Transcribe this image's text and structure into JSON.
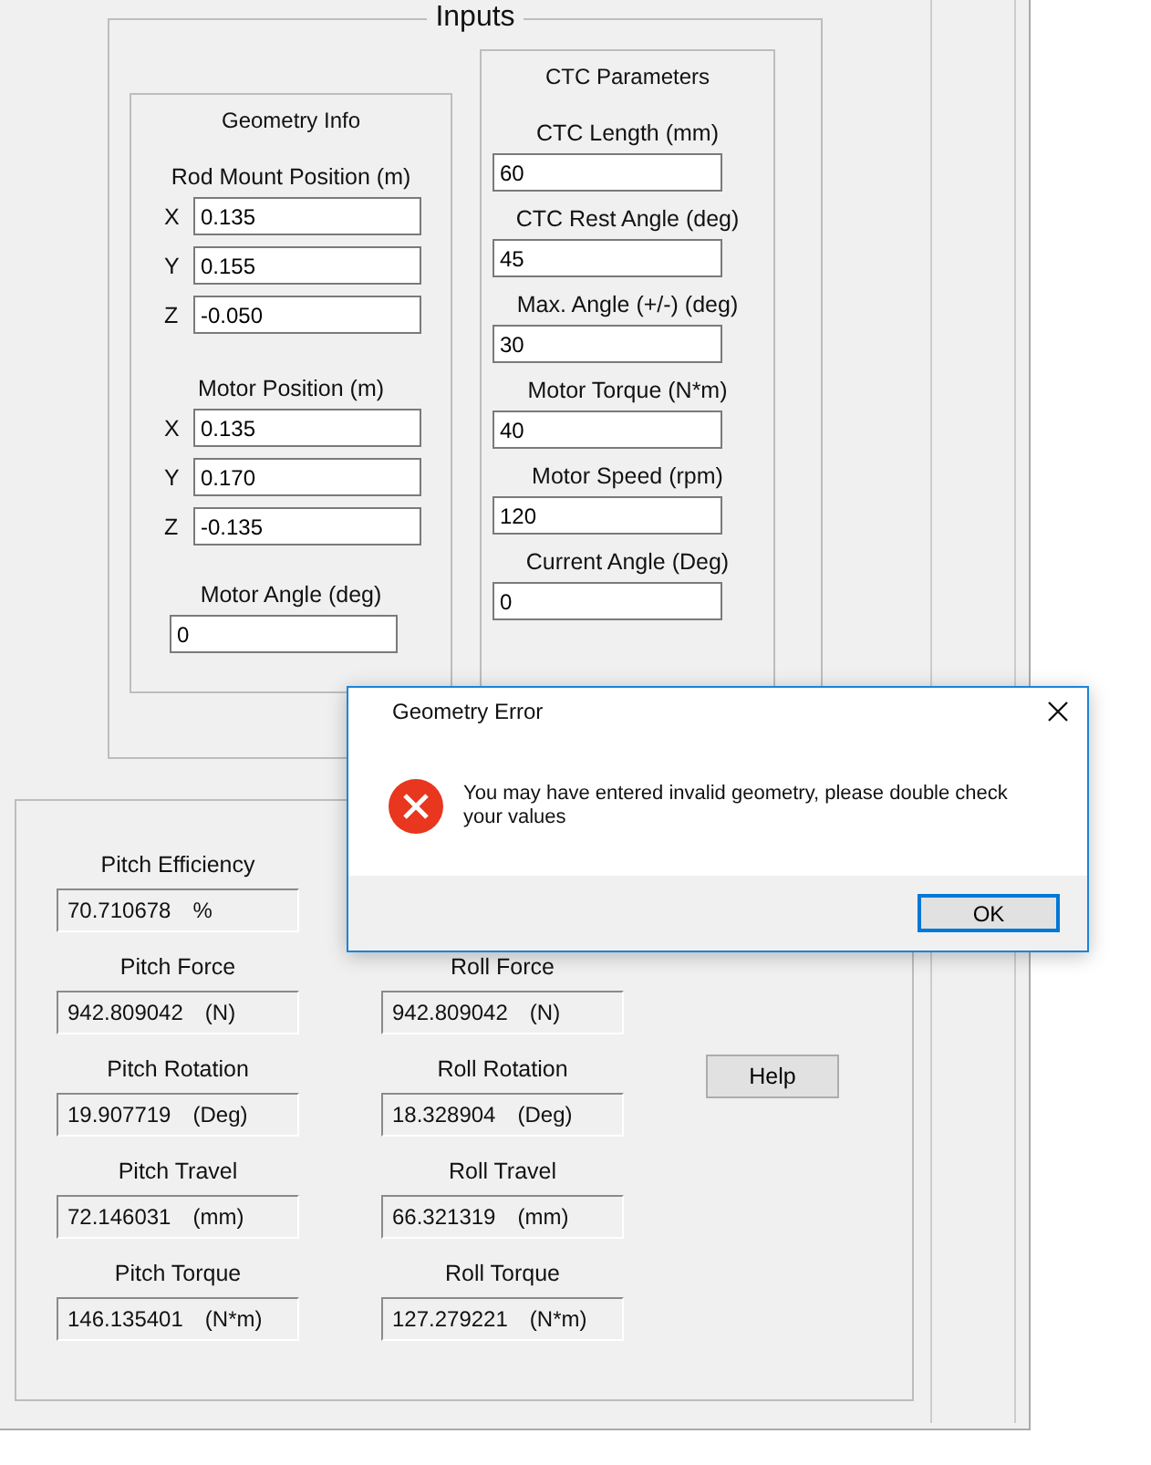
{
  "inputs": {
    "title": "Inputs",
    "geometry": {
      "title": "Geometry Info",
      "sections": [
        {
          "label": "Rod Mount Position (m)",
          "fields": [
            {
              "axis": "X",
              "value": "0.135"
            },
            {
              "axis": "Y",
              "value": "0.155"
            },
            {
              "axis": "Z",
              "value": "-0.050"
            }
          ]
        },
        {
          "label": "Motor Position (m)",
          "fields": [
            {
              "axis": "X",
              "value": "0.135"
            },
            {
              "axis": "Y",
              "value": "0.170"
            },
            {
              "axis": "Z",
              "value": "-0.135"
            }
          ]
        }
      ],
      "motor_angle": {
        "label": "Motor Angle (deg)",
        "value": "0"
      }
    },
    "ctc": {
      "title": "CTC Parameters",
      "fields": [
        {
          "label": "CTC Length (mm)",
          "value": "60"
        },
        {
          "label": "CTC Rest Angle (deg)",
          "value": "45"
        },
        {
          "label": "Max. Angle (+/-) (deg)",
          "value": "30"
        },
        {
          "label": "Motor Torque (N*m)",
          "value": "40"
        },
        {
          "label": "Motor Speed (rpm)",
          "value": "120"
        },
        {
          "label": "Current Angle (Deg)",
          "value": "0"
        }
      ]
    }
  },
  "results": {
    "rows": [
      {
        "pitch": {
          "label": "Pitch Efficiency",
          "value": "70.710678",
          "unit": "%"
        }
      },
      {
        "pitch": {
          "label": "Pitch Force",
          "value": "942.809042",
          "unit": "(N)"
        },
        "roll": {
          "label": "Roll Force",
          "value": "942.809042",
          "unit": "(N)"
        }
      },
      {
        "pitch": {
          "label": "Pitch Rotation",
          "value": "19.907719",
          "unit": "(Deg)"
        },
        "roll": {
          "label": "Roll Rotation",
          "value": "18.328904",
          "unit": "(Deg)"
        }
      },
      {
        "pitch": {
          "label": "Pitch Travel",
          "value": "72.146031",
          "unit": "(mm)"
        },
        "roll": {
          "label": "Roll Travel",
          "value": "66.321319",
          "unit": "(mm)"
        }
      },
      {
        "pitch": {
          "label": "Pitch Torque",
          "value": "146.135401",
          "unit": "(N*m)"
        },
        "roll": {
          "label": "Roll Torque",
          "value": "127.279221",
          "unit": "(N*m)"
        }
      }
    ],
    "help_button": "Help"
  },
  "dialog": {
    "title": "Geometry Error",
    "message": "You may have entered invalid geometry, please double check your values",
    "ok_button": "OK"
  }
}
